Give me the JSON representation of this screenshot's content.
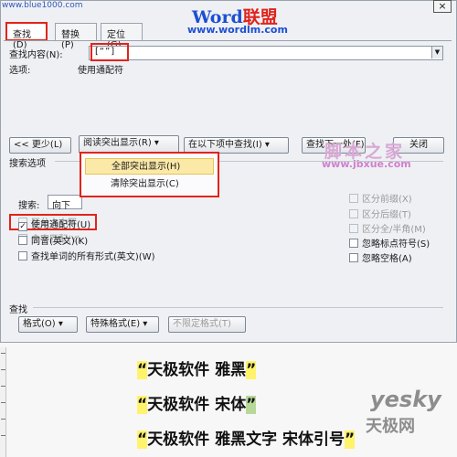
{
  "watermark_top": "www.blue1000.com",
  "brand": {
    "word": "Word",
    "cn": "联盟",
    "url": "www.wordlm.com"
  },
  "tabs": [
    {
      "label": "查找(D)",
      "active": true
    },
    {
      "label": "替换(P)",
      "active": false
    },
    {
      "label": "定位(G)",
      "active": false
    }
  ],
  "find": {
    "label": "查找内容(N):",
    "value": "[“”]",
    "options_label": "选项:",
    "options_value": "使用通配符"
  },
  "buttons": {
    "less": "<< 更少(L)",
    "reading_highlight": "阅读突出显示(R) ▾",
    "find_in": "在以下项中查找(I) ▾",
    "find_next": "查找下一处(F)",
    "close": "关闭"
  },
  "highlight_menu": {
    "items": [
      "全部突出显示(H)",
      "清除突出显示(C)"
    ]
  },
  "search_options": {
    "title": "搜索选项",
    "search_label": "搜索:",
    "search_value": "向下",
    "left": [
      {
        "label": "区分大小写",
        "checked": false,
        "enabled": false
      },
      {
        "label": "全字匹配(Y)",
        "checked": false,
        "enabled": false
      },
      {
        "label": "使用通配符(U)",
        "checked": true,
        "enabled": true
      },
      {
        "label": "同音(英文)(K)",
        "checked": false,
        "enabled": true
      },
      {
        "label": "查找单词的所有形式(英文)(W)",
        "checked": false,
        "enabled": true
      }
    ],
    "right": [
      {
        "label": "区分前缀(X)",
        "checked": false,
        "enabled": false
      },
      {
        "label": "区分后缀(T)",
        "checked": false,
        "enabled": false
      },
      {
        "label": "区分全/半角(M)",
        "checked": false,
        "enabled": false
      },
      {
        "label": "忽略标点符号(S)",
        "checked": false,
        "enabled": true
      },
      {
        "label": "忽略空格(A)",
        "checked": false,
        "enabled": true
      }
    ]
  },
  "find_section": {
    "title": "查找",
    "format": "格式(O) ▾",
    "special": "特殊格式(E) ▾",
    "no_format": "不限定格式(T)"
  },
  "jbx": {
    "title": "脚本之家",
    "url": "www.jbxue.com"
  },
  "document": {
    "lines": [
      {
        "open": "“",
        "text": "天极软件  雅黑",
        "close": "”"
      },
      {
        "open": "“",
        "text": "天极软件  宋体",
        "close": "”"
      },
      {
        "open": "“",
        "text": "天极软件  雅黑文字  宋体引号",
        "close": "”"
      }
    ]
  },
  "yesky": {
    "logo": "yesky",
    "sub": "天极网"
  },
  "colors": {
    "highlight_red": "#e2231a",
    "quote_yellow": "#fff36b",
    "quote_green": "#b8d89a"
  }
}
